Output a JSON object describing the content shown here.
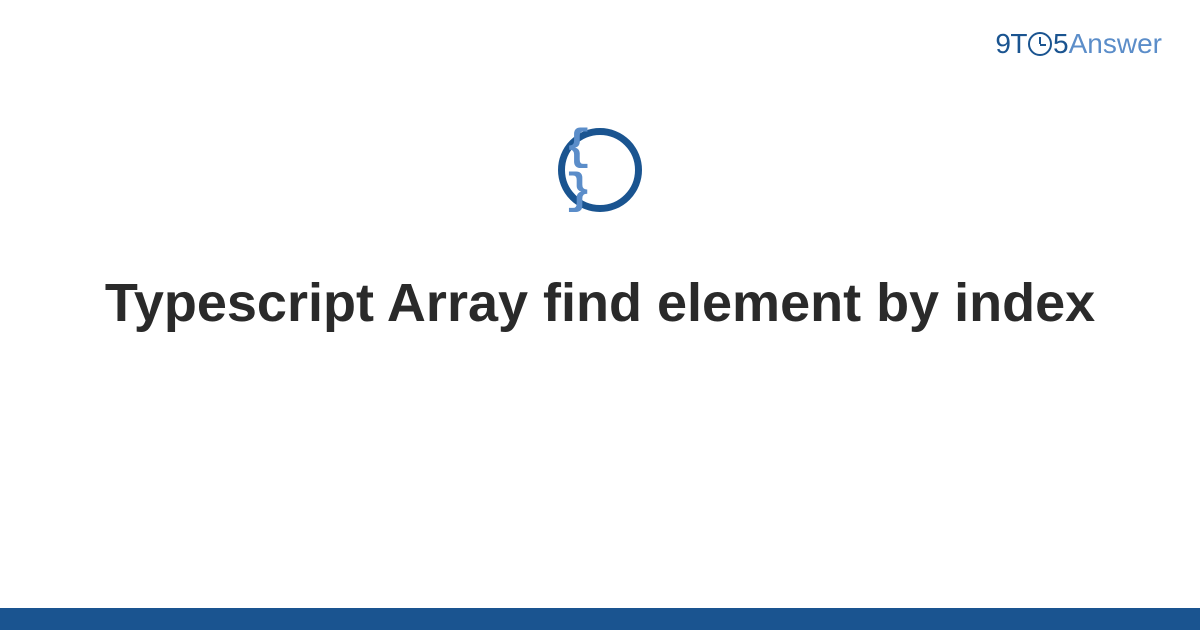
{
  "logo": {
    "part1": "9T",
    "part2": "5",
    "part3": "Answer"
  },
  "category_icon": {
    "symbol": "{ }",
    "name": "code-braces"
  },
  "title": "Typescript Array find element by index",
  "colors": {
    "primary": "#1a5490",
    "secondary": "#5b8dc9"
  }
}
